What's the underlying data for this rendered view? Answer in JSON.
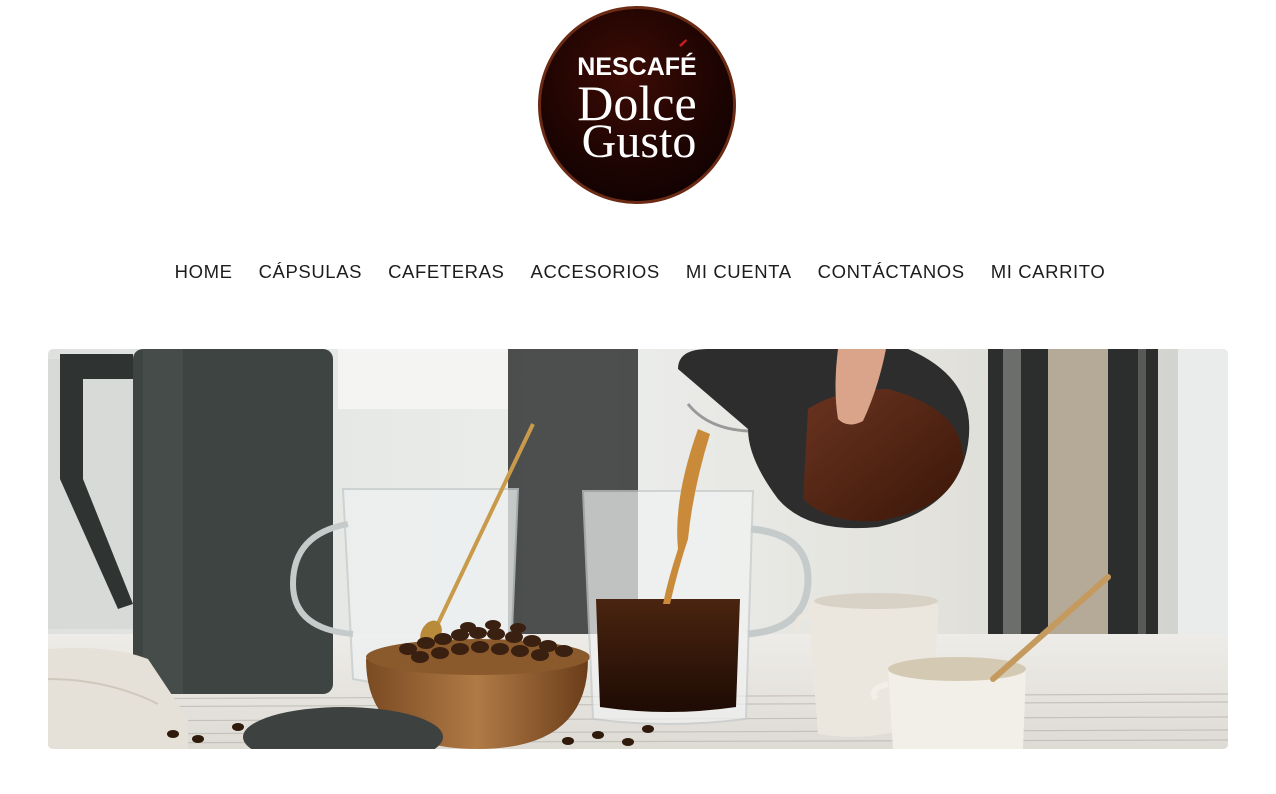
{
  "header": {
    "logo": {
      "brand_line": "NESCAFÉ",
      "name_line1": "Dolce",
      "name_line2": "Gusto",
      "colors": {
        "outer": "#3a0c06",
        "inner": "#1a0503",
        "text": "#ffffff",
        "accent": "#c21f1f"
      }
    }
  },
  "nav": {
    "items": [
      {
        "label": "HOME"
      },
      {
        "label": "CÁPSULAS"
      },
      {
        "label": "CAFETERAS"
      },
      {
        "label": "ACCESORIOS"
      },
      {
        "label": "MI CUENTA"
      },
      {
        "label": "CONTÁCTANOS"
      },
      {
        "label": "MI CARRITO"
      }
    ]
  },
  "hero": {
    "image_subject": "coffee-pouring-scene"
  }
}
